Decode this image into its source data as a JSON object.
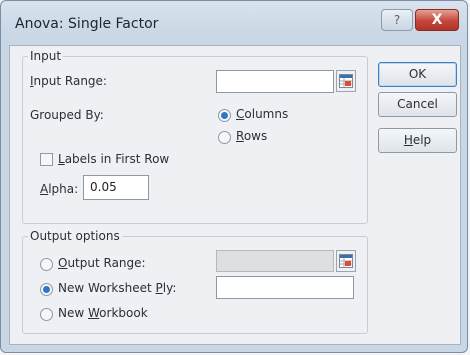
{
  "window": {
    "title": "Anova: Single Factor",
    "help_symbol": "?",
    "close_symbol": "X"
  },
  "input_group": {
    "title": "Input",
    "input_range_label": "Input Range:",
    "input_range_value": "",
    "grouped_by_label": "Grouped By:",
    "columns_label": "Columns",
    "rows_label": "Rows",
    "grouped_by_selected": "Columns",
    "labels_first_row": "Labels in First Row",
    "labels_checked": false,
    "alpha_label": "Alpha:",
    "alpha_value": "0.05"
  },
  "output_group": {
    "title": "Output options",
    "output_range_label": "Output Range:",
    "new_worksheet_ply_label": "New Worksheet Ply:",
    "new_workbook_label": "New Workbook",
    "selected": "New Worksheet Ply:"
  },
  "buttons": {
    "ok": "OK",
    "cancel": "Cancel",
    "help": "Help"
  },
  "colors": {
    "accent": "#2f76c6",
    "close_button": "#c6463a",
    "title_bar": "#cbd8e6"
  }
}
